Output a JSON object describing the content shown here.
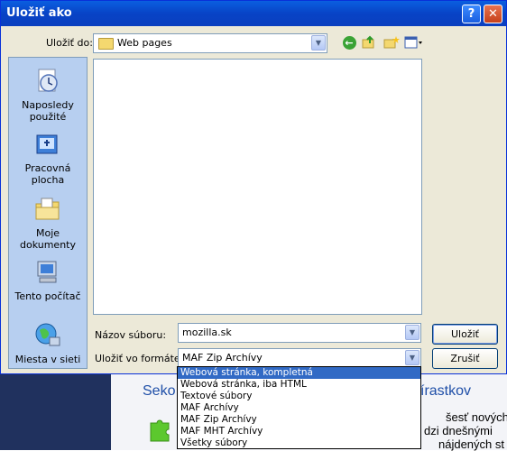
{
  "dialog": {
    "title": "Uložiť ako",
    "help_glyph": "?",
    "close_glyph": "✕"
  },
  "lookin": {
    "label": "Uložiť do:",
    "value": "Web pages"
  },
  "places": [
    {
      "label": "Naposledy použité",
      "icon": "recent-documents-icon"
    },
    {
      "label": "Pracovná plocha",
      "icon": "desktop-icon"
    },
    {
      "label": "Moje dokumenty",
      "icon": "my-documents-icon"
    },
    {
      "label": "Tento počítač",
      "icon": "my-computer-icon"
    },
    {
      "label": "Miesta v sieti",
      "icon": "network-places-icon"
    }
  ],
  "filename": {
    "label": "Názov súboru:",
    "value": "mozilla.sk"
  },
  "filetype": {
    "label": "Uložiť vo formáte:",
    "value": "MAF Zip Archívy",
    "options": [
      "Webová stránka, kompletná",
      "Webová stránka, iba HTML",
      "Textové súbory",
      "MAF Archívy",
      "MAF Zip Archívy",
      "MAF MHT Archívy",
      "Všetky súbory"
    ],
    "highlighted_index": 0
  },
  "buttons": {
    "save": "Uložiť",
    "cancel": "Zrušiť"
  },
  "background_page": {
    "heading_left": "Seko",
    "heading_right": "írastkov",
    "text_lines": [
      "šesť nových",
      "dzi dnešnými",
      "nájdených st"
    ]
  },
  "colors": {
    "titlebar": "#0a5fe0",
    "selection": "#316ac5",
    "dialog_face": "#ece9d8"
  }
}
